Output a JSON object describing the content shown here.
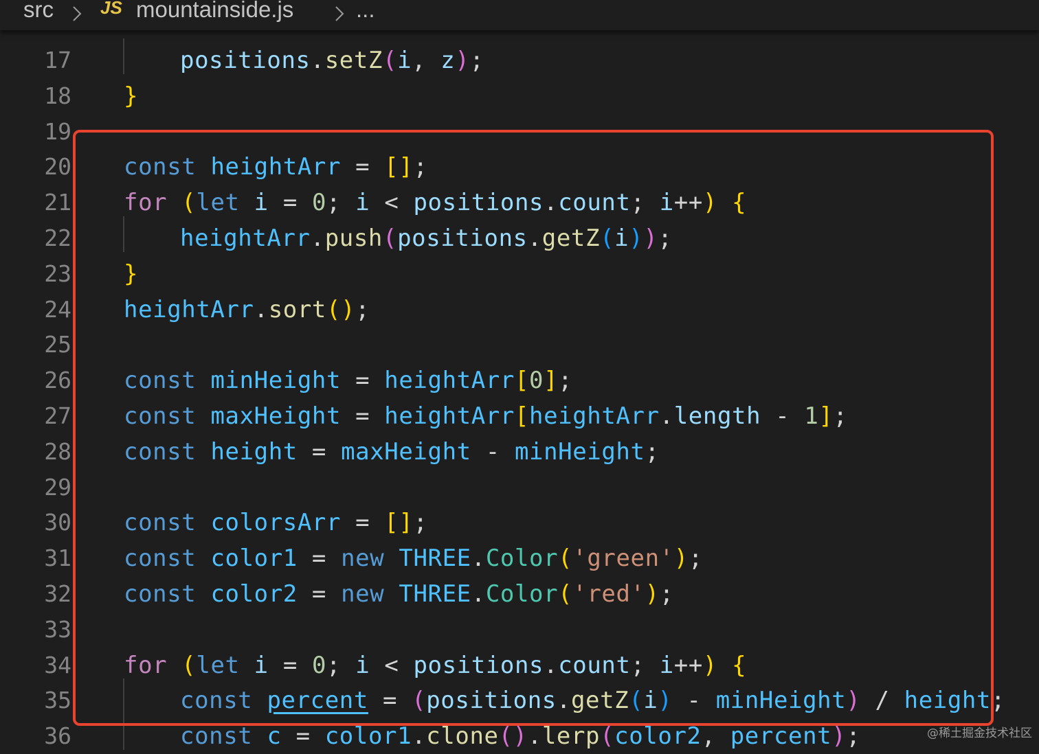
{
  "breadcrumb": {
    "folder": "src",
    "file_icon": "JS",
    "file": "mountainside.js",
    "more": "..."
  },
  "colors": {
    "background": "#1e1e1e",
    "keyword": "#569cd6",
    "control": "#c586c0",
    "variable": "#9cdcfe",
    "function": "#dcdcaa",
    "class": "#4ec9b0",
    "string": "#ce9178",
    "number": "#b5cea8",
    "highlight_box": "#e8432e"
  },
  "watermark": "@稀土掘金技术社区",
  "lines": [
    {
      "n": "17",
      "indent": 2,
      "tokens": [
        [
          "var",
          "positions"
        ],
        [
          "op",
          "."
        ],
        [
          "fn",
          "setZ"
        ],
        [
          "b2",
          "("
        ],
        [
          "var",
          "i"
        ],
        [
          "op",
          ", "
        ],
        [
          "var",
          "z"
        ],
        [
          "b2",
          ")"
        ],
        [
          "op",
          ";"
        ]
      ]
    },
    {
      "n": "18",
      "indent": 1,
      "tokens": [
        [
          "b1",
          "}"
        ]
      ]
    },
    {
      "n": "19",
      "indent": 0,
      "tokens": []
    },
    {
      "n": "20",
      "indent": 1,
      "tokens": [
        [
          "kw",
          "const"
        ],
        [
          "op",
          " "
        ],
        [
          "cst",
          "heightArr"
        ],
        [
          "op",
          " = "
        ],
        [
          "b1",
          "[]"
        ],
        [
          "op",
          ";"
        ]
      ]
    },
    {
      "n": "21",
      "indent": 1,
      "tokens": [
        [
          "ctl",
          "for"
        ],
        [
          "op",
          " "
        ],
        [
          "b1",
          "("
        ],
        [
          "kw",
          "let"
        ],
        [
          "op",
          " "
        ],
        [
          "var",
          "i"
        ],
        [
          "op",
          " = "
        ],
        [
          "num",
          "0"
        ],
        [
          "op",
          "; "
        ],
        [
          "var",
          "i"
        ],
        [
          "op",
          " < "
        ],
        [
          "var",
          "positions"
        ],
        [
          "op",
          "."
        ],
        [
          "var",
          "count"
        ],
        [
          "op",
          "; "
        ],
        [
          "var",
          "i"
        ],
        [
          "op",
          "++"
        ],
        [
          "b1",
          ")"
        ],
        [
          "op",
          " "
        ],
        [
          "b1",
          "{"
        ]
      ]
    },
    {
      "n": "22",
      "indent": 2,
      "tokens": [
        [
          "cst",
          "heightArr"
        ],
        [
          "op",
          "."
        ],
        [
          "fn",
          "push"
        ],
        [
          "b2",
          "("
        ],
        [
          "var",
          "positions"
        ],
        [
          "op",
          "."
        ],
        [
          "fn",
          "getZ"
        ],
        [
          "b3",
          "("
        ],
        [
          "var",
          "i"
        ],
        [
          "b3",
          ")"
        ],
        [
          "b2",
          ")"
        ],
        [
          "op",
          ";"
        ]
      ]
    },
    {
      "n": "23",
      "indent": 1,
      "tokens": [
        [
          "b1",
          "}"
        ]
      ]
    },
    {
      "n": "24",
      "indent": 1,
      "tokens": [
        [
          "cst",
          "heightArr"
        ],
        [
          "op",
          "."
        ],
        [
          "fn",
          "sort"
        ],
        [
          "b1",
          "()"
        ],
        [
          "op",
          ";"
        ]
      ]
    },
    {
      "n": "25",
      "indent": 0,
      "tokens": []
    },
    {
      "n": "26",
      "indent": 1,
      "tokens": [
        [
          "kw",
          "const"
        ],
        [
          "op",
          " "
        ],
        [
          "cst",
          "minHeight"
        ],
        [
          "op",
          " = "
        ],
        [
          "cst",
          "heightArr"
        ],
        [
          "b1",
          "["
        ],
        [
          "num",
          "0"
        ],
        [
          "b1",
          "]"
        ],
        [
          "op",
          ";"
        ]
      ]
    },
    {
      "n": "27",
      "indent": 1,
      "tokens": [
        [
          "kw",
          "const"
        ],
        [
          "op",
          " "
        ],
        [
          "cst",
          "maxHeight"
        ],
        [
          "op",
          " = "
        ],
        [
          "cst",
          "heightArr"
        ],
        [
          "b1",
          "["
        ],
        [
          "cst",
          "heightArr"
        ],
        [
          "op",
          "."
        ],
        [
          "var",
          "length"
        ],
        [
          "op",
          " - "
        ],
        [
          "num",
          "1"
        ],
        [
          "b1",
          "]"
        ],
        [
          "op",
          ";"
        ]
      ]
    },
    {
      "n": "28",
      "indent": 1,
      "tokens": [
        [
          "kw",
          "const"
        ],
        [
          "op",
          " "
        ],
        [
          "cst",
          "height"
        ],
        [
          "op",
          " = "
        ],
        [
          "cst",
          "maxHeight"
        ],
        [
          "op",
          " - "
        ],
        [
          "cst",
          "minHeight"
        ],
        [
          "op",
          ";"
        ]
      ]
    },
    {
      "n": "29",
      "indent": 0,
      "tokens": []
    },
    {
      "n": "30",
      "indent": 1,
      "tokens": [
        [
          "kw",
          "const"
        ],
        [
          "op",
          " "
        ],
        [
          "cst",
          "colorsArr"
        ],
        [
          "op",
          " = "
        ],
        [
          "b1",
          "[]"
        ],
        [
          "op",
          ";"
        ]
      ]
    },
    {
      "n": "31",
      "indent": 1,
      "tokens": [
        [
          "kw",
          "const"
        ],
        [
          "op",
          " "
        ],
        [
          "cst",
          "color1"
        ],
        [
          "op",
          " = "
        ],
        [
          "kw",
          "new"
        ],
        [
          "op",
          " "
        ],
        [
          "cst",
          "THREE"
        ],
        [
          "op",
          "."
        ],
        [
          "cls",
          "Color"
        ],
        [
          "b1",
          "("
        ],
        [
          "str",
          "'green'"
        ],
        [
          "b1",
          ")"
        ],
        [
          "op",
          ";"
        ]
      ]
    },
    {
      "n": "32",
      "indent": 1,
      "tokens": [
        [
          "kw",
          "const"
        ],
        [
          "op",
          " "
        ],
        [
          "cst",
          "color2"
        ],
        [
          "op",
          " = "
        ],
        [
          "kw",
          "new"
        ],
        [
          "op",
          " "
        ],
        [
          "cst",
          "THREE"
        ],
        [
          "op",
          "."
        ],
        [
          "cls",
          "Color"
        ],
        [
          "b1",
          "("
        ],
        [
          "str",
          "'red'"
        ],
        [
          "b1",
          ")"
        ],
        [
          "op",
          ";"
        ]
      ]
    },
    {
      "n": "33",
      "indent": 0,
      "tokens": []
    },
    {
      "n": "34",
      "indent": 1,
      "tokens": [
        [
          "ctl",
          "for"
        ],
        [
          "op",
          " "
        ],
        [
          "b1",
          "("
        ],
        [
          "kw",
          "let"
        ],
        [
          "op",
          " "
        ],
        [
          "var",
          "i"
        ],
        [
          "op",
          " = "
        ],
        [
          "num",
          "0"
        ],
        [
          "op",
          "; "
        ],
        [
          "var",
          "i"
        ],
        [
          "op",
          " < "
        ],
        [
          "var",
          "positions"
        ],
        [
          "op",
          "."
        ],
        [
          "var",
          "count"
        ],
        [
          "op",
          "; "
        ],
        [
          "var",
          "i"
        ],
        [
          "op",
          "++"
        ],
        [
          "b1",
          ")"
        ],
        [
          "op",
          " "
        ],
        [
          "b1",
          "{"
        ]
      ]
    },
    {
      "n": "35",
      "indent": 2,
      "tokens": [
        [
          "kw",
          "const"
        ],
        [
          "op",
          " "
        ],
        [
          "cst ul",
          "percent"
        ],
        [
          "op",
          " = "
        ],
        [
          "b2",
          "("
        ],
        [
          "var",
          "positions"
        ],
        [
          "op",
          "."
        ],
        [
          "fn",
          "getZ"
        ],
        [
          "b3",
          "("
        ],
        [
          "var",
          "i"
        ],
        [
          "b3",
          ")"
        ],
        [
          "op",
          " - "
        ],
        [
          "cst",
          "minHeight"
        ],
        [
          "b2",
          ")"
        ],
        [
          "op",
          " / "
        ],
        [
          "cst",
          "height"
        ],
        [
          "op",
          ";"
        ]
      ]
    },
    {
      "n": "36",
      "indent": 2,
      "tokens": [
        [
          "kw",
          "const"
        ],
        [
          "op",
          " "
        ],
        [
          "cst",
          "c"
        ],
        [
          "op",
          " = "
        ],
        [
          "cst",
          "color1"
        ],
        [
          "op",
          "."
        ],
        [
          "fn",
          "clone"
        ],
        [
          "b2",
          "()"
        ],
        [
          "op",
          "."
        ],
        [
          "fn",
          "lerp"
        ],
        [
          "b2",
          "("
        ],
        [
          "cst",
          "color2"
        ],
        [
          "op",
          ", "
        ],
        [
          "cst",
          "percent"
        ],
        [
          "b2",
          ")"
        ],
        [
          "op",
          ";"
        ]
      ]
    }
  ]
}
